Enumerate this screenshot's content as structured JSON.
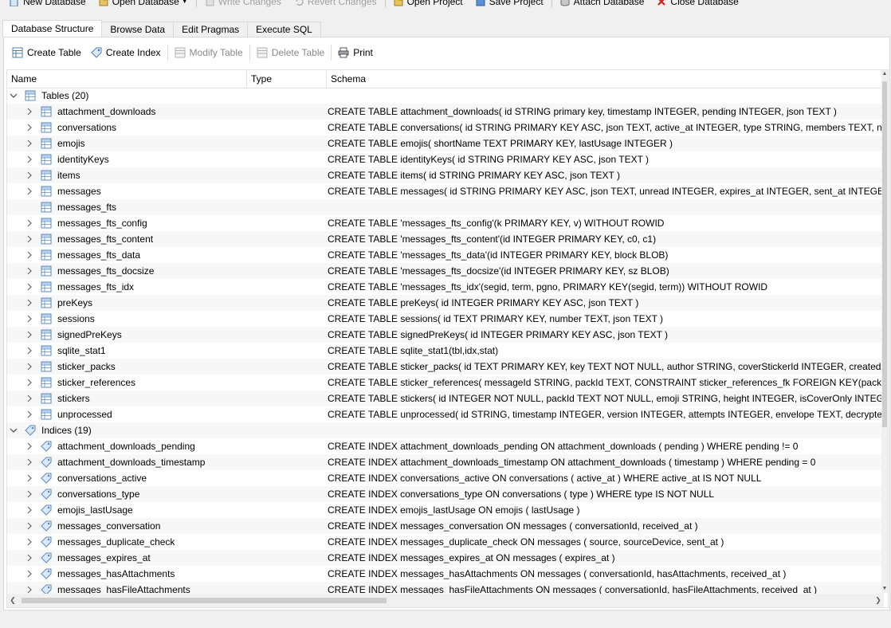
{
  "toolbar": {
    "new_database": "New Database",
    "open_database": "Open Database",
    "write_changes": "Write Changes",
    "revert_changes": "Revert Changes",
    "open_project": "Open Project",
    "save_project": "Save Project",
    "attach_database": "Attach Database",
    "close_database": "Close Database"
  },
  "tabs": [
    "Database Structure",
    "Browse Data",
    "Edit Pragmas",
    "Execute SQL"
  ],
  "actions": {
    "create_table": "Create Table",
    "create_index": "Create Index",
    "modify_table": "Modify Table",
    "delete_table": "Delete Table",
    "print": "Print"
  },
  "columns": [
    "Name",
    "Type",
    "Schema"
  ],
  "tables_group": "Tables (20)",
  "tables": [
    {
      "name": "attachment_downloads",
      "schema": "CREATE TABLE attachment_downloads( id STRING primary key, timestamp INTEGER, pending INTEGER, json TEXT )"
    },
    {
      "name": "conversations",
      "schema": "CREATE TABLE conversations( id STRING PRIMARY KEY ASC, json TEXT, active_at INTEGER, type STRING, members TEXT, name TEXT, p"
    },
    {
      "name": "emojis",
      "schema": "CREATE TABLE emojis( shortName TEXT PRIMARY KEY, lastUsage INTEGER )"
    },
    {
      "name": "identityKeys",
      "schema": "CREATE TABLE identityKeys( id STRING PRIMARY KEY ASC, json TEXT )"
    },
    {
      "name": "items",
      "schema": "CREATE TABLE items( id STRING PRIMARY KEY ASC, json TEXT )"
    },
    {
      "name": "messages",
      "schema": "CREATE TABLE messages( id STRING PRIMARY KEY ASC, json TEXT, unread INTEGER, expires_at INTEGER, sent_at INTEGER, schemaVers"
    },
    {
      "name": "messages_fts",
      "schema": ""
    },
    {
      "name": "messages_fts_config",
      "schema": "CREATE TABLE 'messages_fts_config'(k PRIMARY KEY, v) WITHOUT ROWID"
    },
    {
      "name": "messages_fts_content",
      "schema": "CREATE TABLE 'messages_fts_content'(id INTEGER PRIMARY KEY, c0, c1)"
    },
    {
      "name": "messages_fts_data",
      "schema": "CREATE TABLE 'messages_fts_data'(id INTEGER PRIMARY KEY, block BLOB)"
    },
    {
      "name": "messages_fts_docsize",
      "schema": "CREATE TABLE 'messages_fts_docsize'(id INTEGER PRIMARY KEY, sz BLOB)"
    },
    {
      "name": "messages_fts_idx",
      "schema": "CREATE TABLE 'messages_fts_idx'(segid, term, pgno, PRIMARY KEY(segid, term)) WITHOUT ROWID"
    },
    {
      "name": "preKeys",
      "schema": "CREATE TABLE preKeys( id INTEGER PRIMARY KEY ASC, json TEXT )"
    },
    {
      "name": "sessions",
      "schema": "CREATE TABLE sessions( id TEXT PRIMARY KEY, number TEXT, json TEXT )"
    },
    {
      "name": "signedPreKeys",
      "schema": "CREATE TABLE signedPreKeys( id INTEGER PRIMARY KEY ASC, json TEXT )"
    },
    {
      "name": "sqlite_stat1",
      "schema": "CREATE TABLE sqlite_stat1(tbl,idx,stat)"
    },
    {
      "name": "sticker_packs",
      "schema": "CREATE TABLE sticker_packs( id TEXT PRIMARY KEY, key TEXT NOT NULL, author STRING, coverStickerId INTEGER, createdAt INTEGER,"
    },
    {
      "name": "sticker_references",
      "schema": "CREATE TABLE sticker_references( messageId STRING, packId TEXT, CONSTRAINT sticker_references_fk FOREIGN KEY(packId) REFEREN"
    },
    {
      "name": "stickers",
      "schema": "CREATE TABLE stickers( id INTEGER NOT NULL, packId TEXT NOT NULL, emoji STRING, height INTEGER, isCoverOnly INTEGER, lastUsec"
    },
    {
      "name": "unprocessed",
      "schema": "CREATE TABLE unprocessed( id STRING, timestamp INTEGER, version INTEGER, attempts INTEGER, envelope TEXT, decrypted TEXT, sou"
    }
  ],
  "indices_group": "Indices (19)",
  "indices": [
    {
      "name": "attachment_downloads_pending",
      "schema": "CREATE INDEX attachment_downloads_pending ON attachment_downloads ( pending ) WHERE pending != 0"
    },
    {
      "name": "attachment_downloads_timestamp",
      "schema": "CREATE INDEX attachment_downloads_timestamp ON attachment_downloads ( timestamp ) WHERE pending = 0"
    },
    {
      "name": "conversations_active",
      "schema": "CREATE INDEX conversations_active ON conversations ( active_at ) WHERE active_at IS NOT NULL"
    },
    {
      "name": "conversations_type",
      "schema": "CREATE INDEX conversations_type ON conversations ( type ) WHERE type IS NOT NULL"
    },
    {
      "name": "emojis_lastUsage",
      "schema": "CREATE INDEX emojis_lastUsage ON emojis ( lastUsage )"
    },
    {
      "name": "messages_conversation",
      "schema": "CREATE INDEX messages_conversation ON messages ( conversationId, received_at )"
    },
    {
      "name": "messages_duplicate_check",
      "schema": "CREATE INDEX messages_duplicate_check ON messages ( source, sourceDevice, sent_at )"
    },
    {
      "name": "messages_expires_at",
      "schema": "CREATE INDEX messages_expires_at ON messages ( expires_at )"
    },
    {
      "name": "messages_hasAttachments",
      "schema": "CREATE INDEX messages_hasAttachments ON messages ( conversationId, hasAttachments, received_at )"
    },
    {
      "name": "messages_hasFileAttachments",
      "schema": "CREATE INDEX messages_hasFileAttachments ON messages ( conversationId, hasFileAttachments, received_at )"
    }
  ]
}
